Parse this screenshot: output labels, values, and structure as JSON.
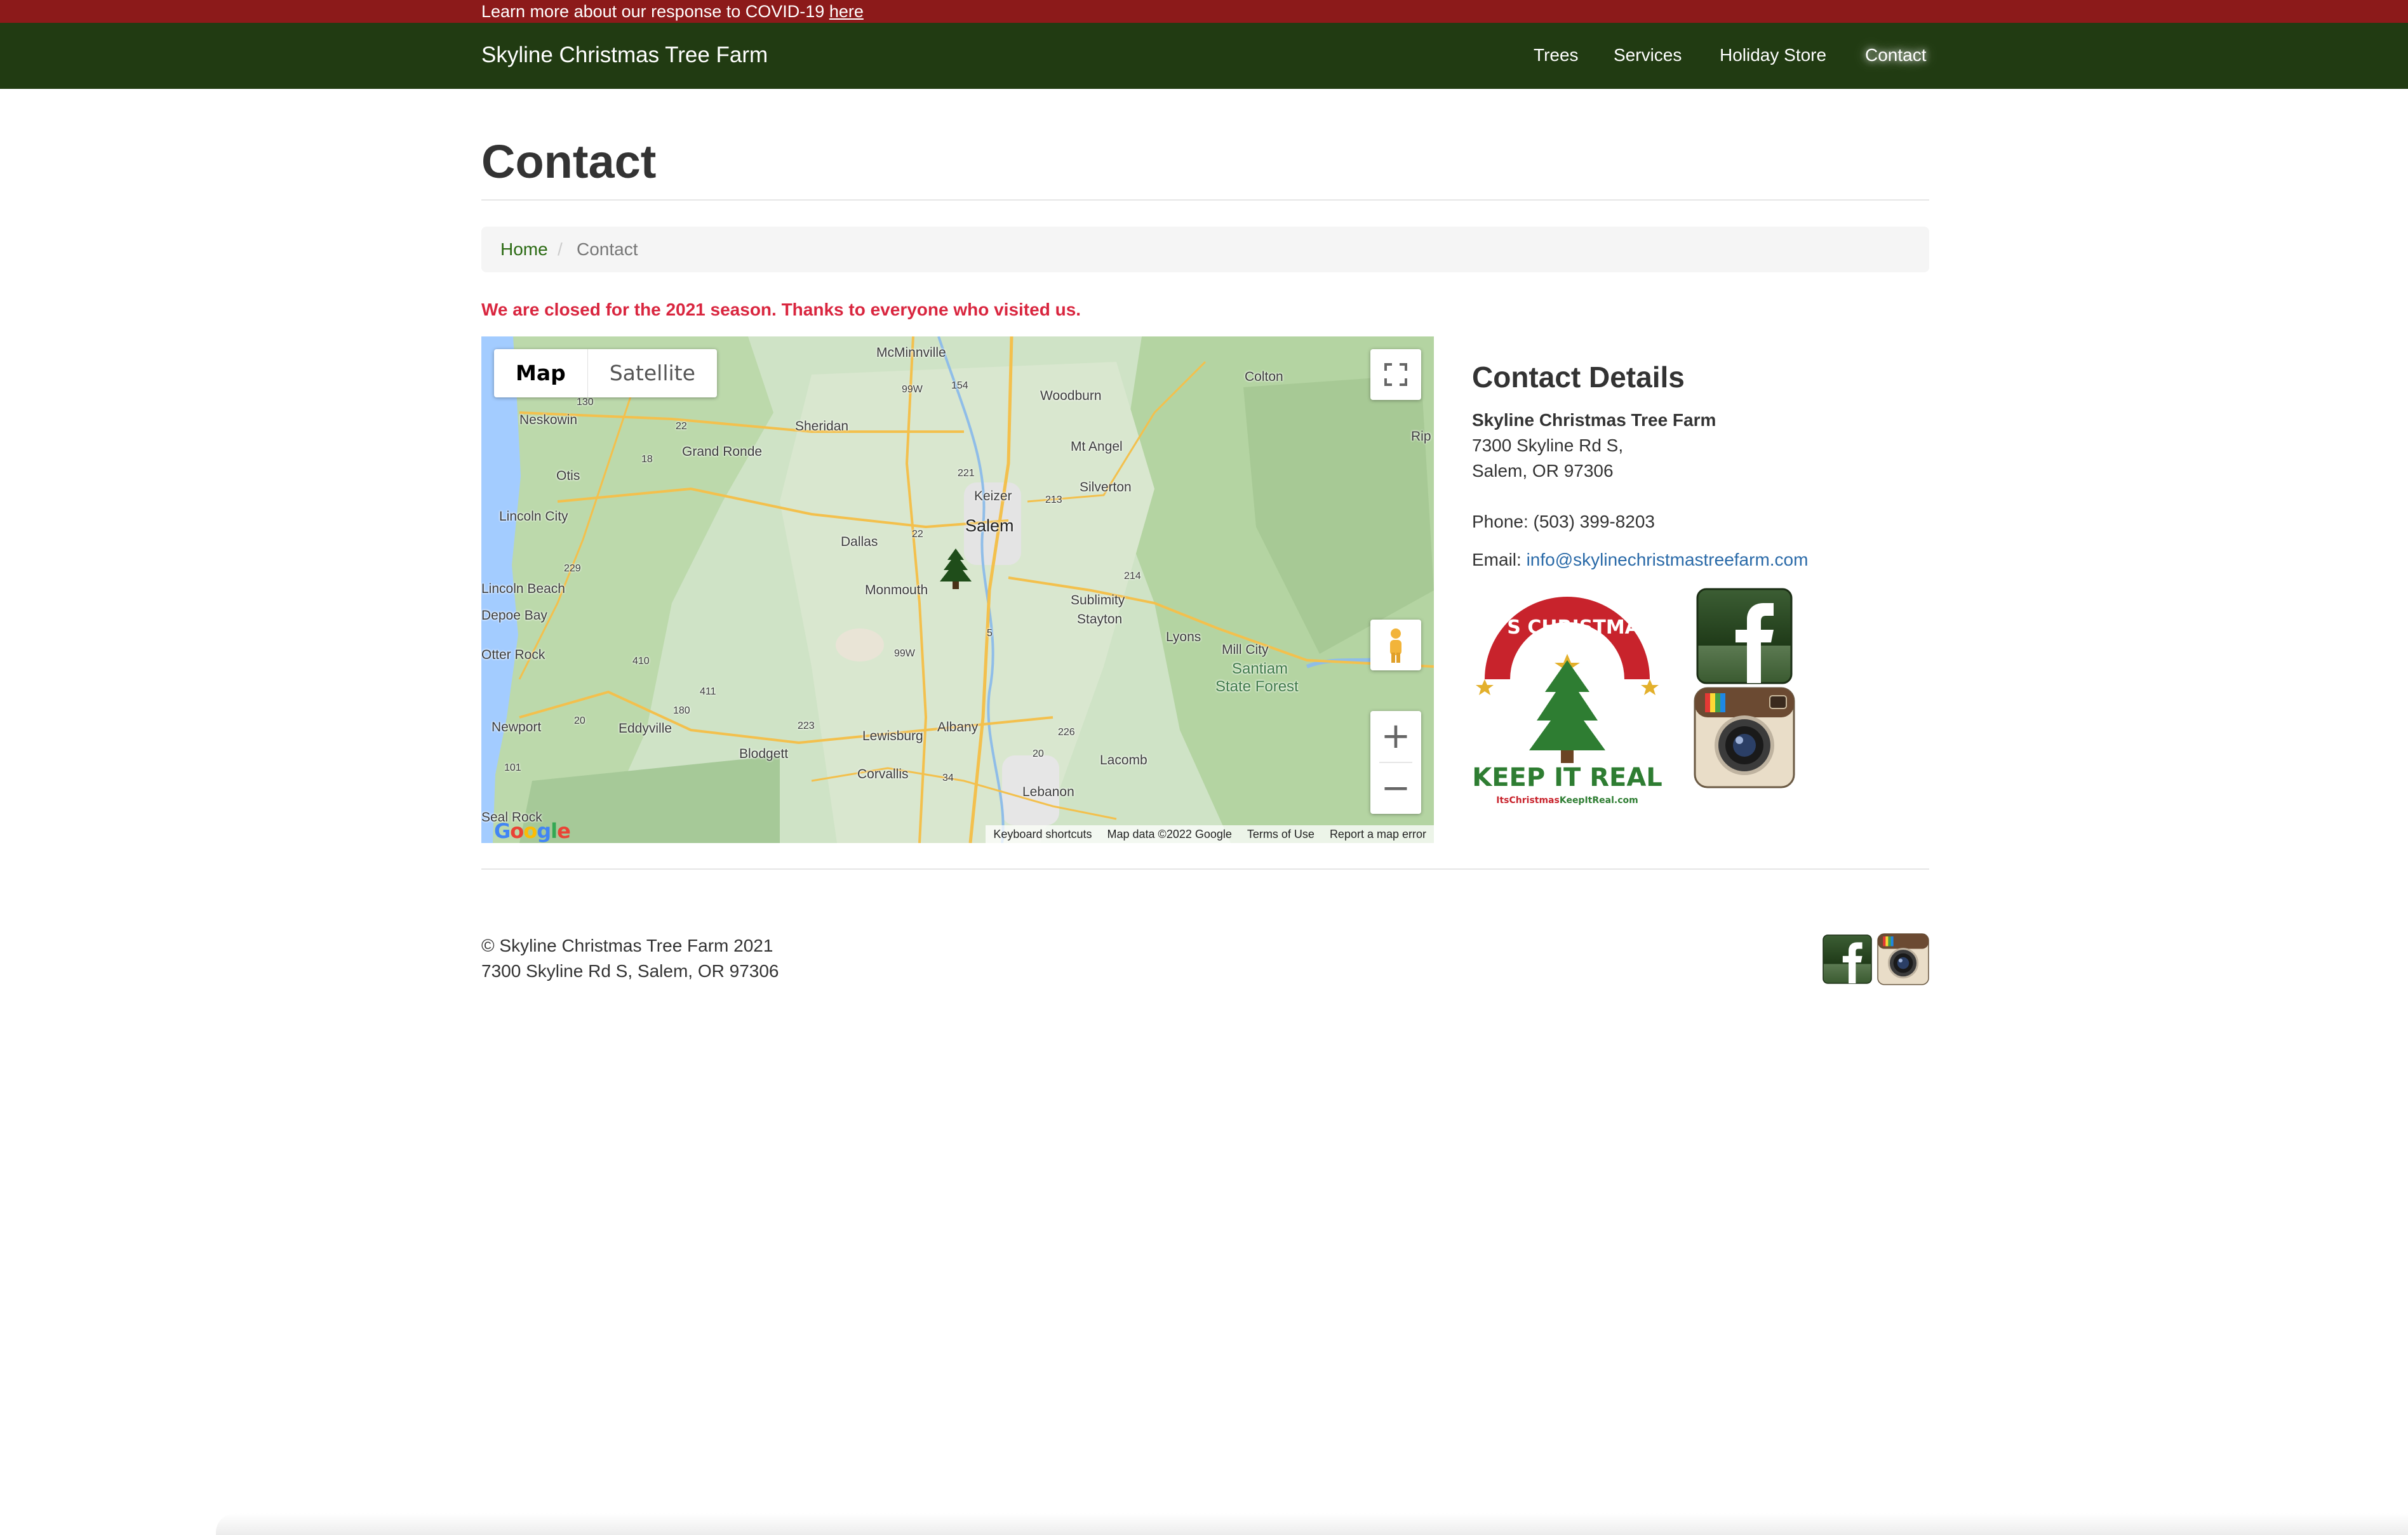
{
  "covid": {
    "text": "Learn more about our response to COVID-19",
    "link": "here"
  },
  "navbar": {
    "brand": "Skyline Christmas Tree Farm",
    "items": [
      "Trees",
      "Services",
      "Holiday Store",
      "Contact"
    ],
    "active": "Contact"
  },
  "page": {
    "title": "Contact",
    "breadcrumb": {
      "home": "Home",
      "separator": "/",
      "current": "Contact"
    },
    "notice": "We are closed for the 2021 season. Thanks to everyone who visited us."
  },
  "map": {
    "type_buttons": [
      "Map",
      "Satellite"
    ],
    "selected_type": "Map",
    "zoom_in": "+",
    "zoom_out": "−",
    "places": {
      "mcminnville": "McMinnville",
      "colton": "Colton",
      "woodburn": "Woodburn",
      "rip": "Rip",
      "neskowin": "Neskowin",
      "sheridan": "Sheridan",
      "grand_ronde": "Grand Ronde",
      "mt_angel": "Mt Angel",
      "otis": "Otis",
      "keizer": "Keizer",
      "silverton": "Silverton",
      "lincoln_city": "Lincoln City",
      "salem": "Salem",
      "dallas": "Dallas",
      "monmouth": "Monmouth",
      "lincoln_beach": "Lincoln Beach",
      "depoe_bay": "Depoe Bay",
      "sublimity": "Sublimity",
      "stayton": "Stayton",
      "lyons": "Lyons",
      "otter_rock": "Otter Rock",
      "mill_city": "Mill City",
      "santiam": "Santiam",
      "state_forest": "State Forest",
      "newport": "Newport",
      "eddyville": "Eddyville",
      "lewisburg": "Lewisburg",
      "albany": "Albany",
      "blodgett": "Blodgett",
      "lacomb": "Lacomb",
      "corvallis": "Corvallis",
      "lebanon": "Lebanon",
      "seal_rock": "Seal Rock"
    },
    "shields": [
      "130",
      "99W",
      "154",
      "22",
      "18",
      "221",
      "213",
      "229",
      "214",
      "410",
      "411",
      "180",
      "20",
      "223",
      "101",
      "226",
      "34",
      "5",
      "99W",
      "20",
      "22"
    ],
    "attribution": [
      "Keyboard shortcuts",
      "Map data ©2022 Google",
      "Terms of Use",
      "Report a map error"
    ],
    "google_logo": "Google",
    "colors": {
      "water": "#a3ccff",
      "land": "#cfe3c6",
      "forest": "#b4d4a2",
      "roads": "#f3c04d",
      "marker": "#1f4d1a"
    }
  },
  "contact": {
    "heading": "Contact Details",
    "name": "Skyline Christmas Tree Farm",
    "address_line1": "7300 Skyline Rd S,",
    "address_line2": "Salem, OR 97306",
    "phone_label": "Phone:",
    "phone": "(503) 399-8203",
    "email_label": "Email:",
    "email": "info@skylinechristmastreefarm.com"
  },
  "badge": {
    "top": "IT'S CHRISTMAS",
    "bottom": "KEEP IT REAL",
    "url_part1": "ItsChristmas",
    "url_part2": "KeepItReal.com"
  },
  "icons": {
    "facebook": "facebook-icon",
    "instagram": "instagram-icon"
  },
  "footer": {
    "copyright": "© Skyline Christmas Tree Farm 2021",
    "address": "7300 Skyline Rd S, Salem, OR 97306"
  }
}
